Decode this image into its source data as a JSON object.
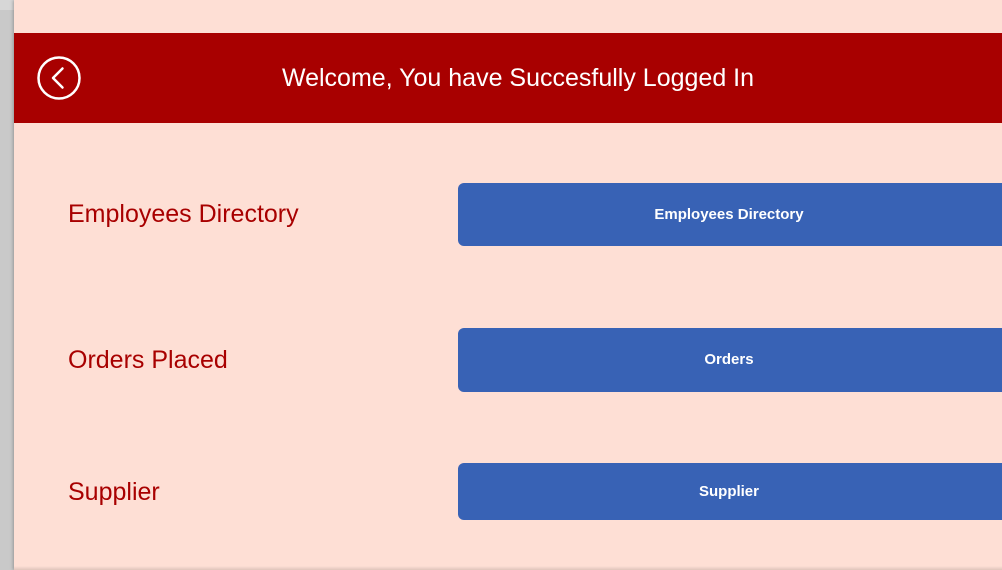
{
  "header": {
    "title": "Welcome, You have Succesfully Logged In",
    "back_icon": "chevron-left-circle-icon",
    "color": "#a80000"
  },
  "rows": [
    {
      "label": "Employees Directory",
      "button_label": "Employees Directory"
    },
    {
      "label": "Orders Placed",
      "button_label": "Orders"
    },
    {
      "label": "Supplier",
      "button_label": "Supplier"
    }
  ],
  "colors": {
    "background": "#fedfd5",
    "label_text": "#a80000",
    "button": "#3862b5",
    "button_text": "#ffffff"
  }
}
